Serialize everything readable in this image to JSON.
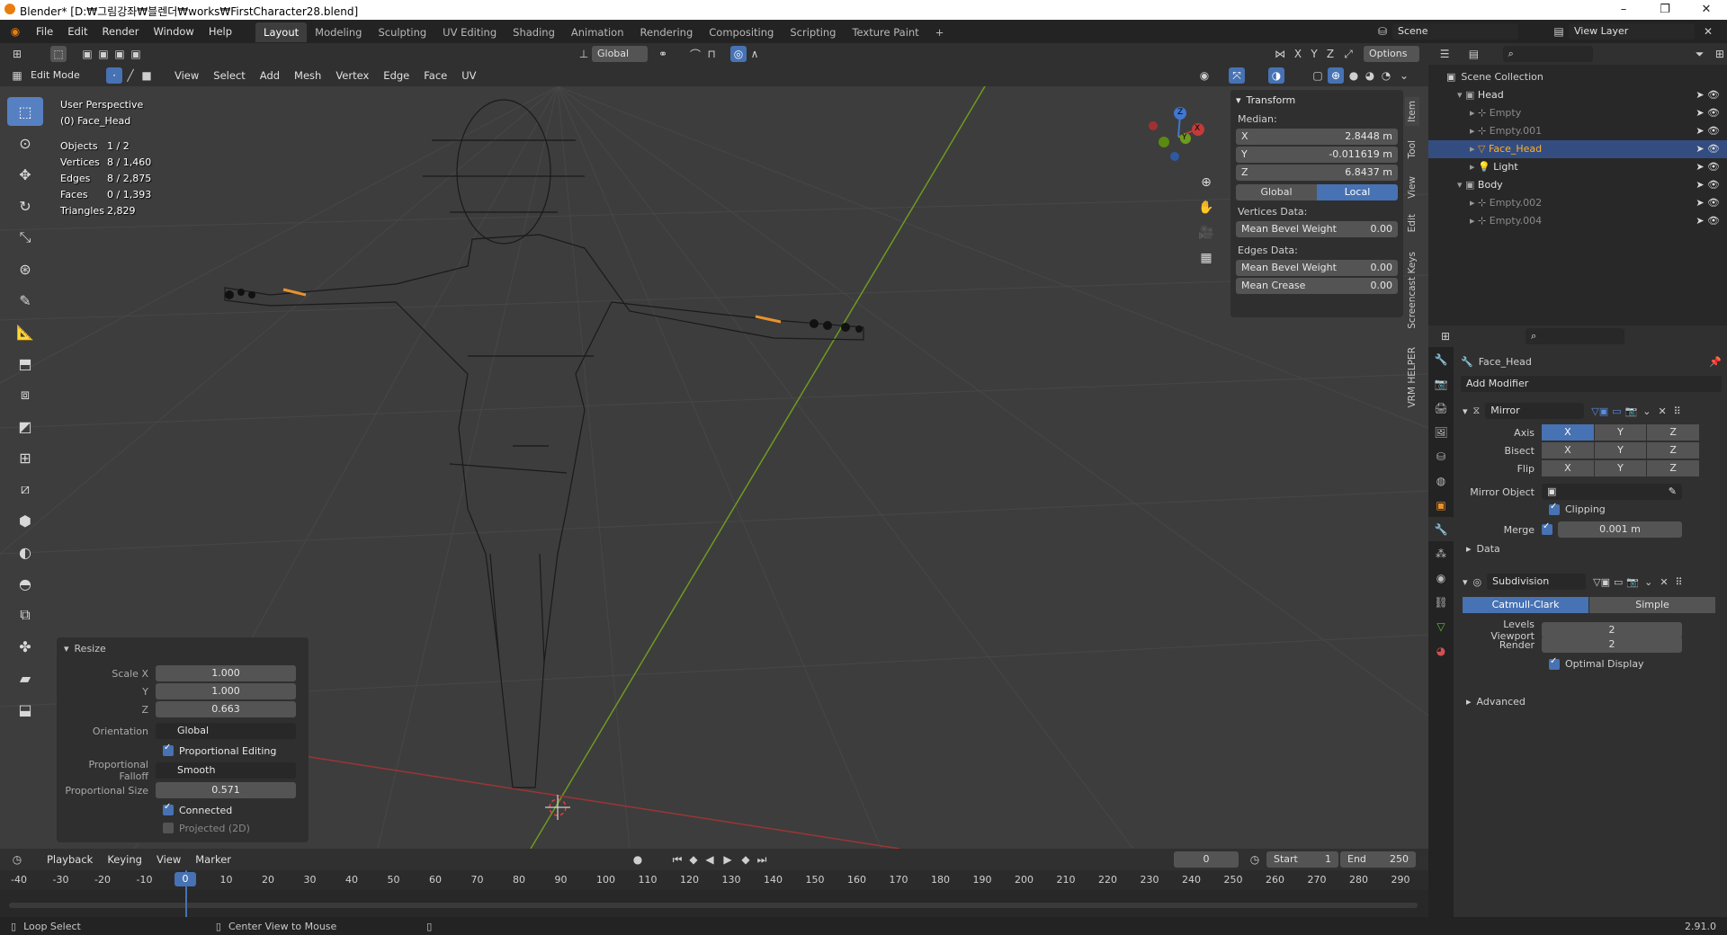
{
  "window": {
    "title": "Blender* [D:₩그림강좌₩블렌더₩works₩FirstCharacter28.blend]",
    "controls": [
      "–",
      "❐",
      "✕"
    ]
  },
  "menu": [
    "File",
    "Edit",
    "Render",
    "Window",
    "Help"
  ],
  "workspaces": [
    "Layout",
    "Modeling",
    "Sculpting",
    "UV Editing",
    "Shading",
    "Animation",
    "Rendering",
    "Compositing",
    "Scripting",
    "Texture Paint"
  ],
  "workspace_add": "+",
  "scene": {
    "label": "Scene",
    "view_layer": "View Layer"
  },
  "tool_header": {
    "orientation": "Global",
    "axes": [
      "X",
      "Y",
      "Z"
    ],
    "options": "Options"
  },
  "vp_header": {
    "mode": "Edit Mode",
    "menus": [
      "View",
      "Select",
      "Add",
      "Mesh",
      "Vertex",
      "Edge",
      "Face",
      "UV"
    ]
  },
  "viewport": {
    "perspective": "User Perspective",
    "object": "(0) Face_Head",
    "stats": [
      {
        "label": "Objects",
        "value": "1 / 2"
      },
      {
        "label": "Vertices",
        "value": "8 / 1,460"
      },
      {
        "label": "Edges",
        "value": "8 / 2,875"
      },
      {
        "label": "Faces",
        "value": "0 / 1,393"
      },
      {
        "label": "Triangles",
        "value": "2,829"
      }
    ],
    "gizmo": {
      "x": "X",
      "y": "Y",
      "z": "Z"
    }
  },
  "npanel": {
    "title": "Transform",
    "median_label": "Median:",
    "x": {
      "label": "X",
      "value": "2.8448 m"
    },
    "y": {
      "label": "Y",
      "value": "-0.011619 m"
    },
    "z": {
      "label": "Z",
      "value": "6.8437 m"
    },
    "space_global": "Global",
    "space_local": "Local",
    "vertices_data": "Vertices Data:",
    "vertex_bevel": {
      "label": "Mean Bevel Weight",
      "value": "0.00"
    },
    "edges_data": "Edges Data:",
    "edge_bevel": {
      "label": "Mean Bevel Weight",
      "value": "0.00"
    },
    "edge_crease": {
      "label": "Mean Crease",
      "value": "0.00"
    },
    "side_tabs": [
      "Item",
      "Tool",
      "View",
      "Edit",
      "Screencast Keys",
      "VRM HELPER"
    ]
  },
  "resize": {
    "title": "Resize",
    "scale_x": {
      "label": "Scale X",
      "value": "1.000"
    },
    "scale_y": {
      "label": "Y",
      "value": "1.000"
    },
    "scale_z": {
      "label": "Z",
      "value": "0.663"
    },
    "orientation": {
      "label": "Orientation",
      "value": "Global"
    },
    "proportional_editing": "Proportional Editing",
    "falloff": {
      "label": "Proportional Falloff",
      "value": "Smooth"
    },
    "size": {
      "label": "Proportional Size",
      "value": "0.571"
    },
    "connected": "Connected",
    "projected": "Projected (2D)"
  },
  "outliner": {
    "root": "Scene Collection",
    "rows": [
      {
        "name": "Head",
        "indent": 1,
        "type": "collection"
      },
      {
        "name": "Empty",
        "indent": 2,
        "type": "empty"
      },
      {
        "name": "Empty.001",
        "indent": 2,
        "type": "empty"
      },
      {
        "name": "Face_Head",
        "indent": 2,
        "type": "mesh",
        "selected": true
      },
      {
        "name": "Light",
        "indent": 2,
        "type": "light"
      },
      {
        "name": "Body",
        "indent": 1,
        "type": "collection"
      },
      {
        "name": "Empty.002",
        "indent": 2,
        "type": "empty"
      },
      {
        "name": "Empty.004",
        "indent": 2,
        "type": "empty"
      }
    ]
  },
  "properties": {
    "object_name": "Face_Head",
    "add_modifier": "Add Modifier",
    "mirror": {
      "name": "Mirror",
      "axis_label": "Axis",
      "bisect_label": "Bisect",
      "flip_label": "Flip",
      "axes": [
        "X",
        "Y",
        "Z"
      ],
      "mirror_object_label": "Mirror Object",
      "clipping": "Clipping",
      "merge_label": "Merge",
      "merge_value": "0.001 m",
      "data": "Data"
    },
    "subdivision": {
      "name": "Subdivision",
      "catmull": "Catmull-Clark",
      "simple": "Simple",
      "levels_viewport": {
        "label": "Levels Viewport",
        "value": "2"
      },
      "render": {
        "label": "Render",
        "value": "2"
      },
      "optimal": "Optimal Display",
      "advanced": "Advanced"
    }
  },
  "timeline": {
    "menus": [
      "Playback",
      "Keying",
      "View",
      "Marker"
    ],
    "current": "0",
    "start_label": "Start",
    "start": "1",
    "end_label": "End",
    "end": "250",
    "ticks": [
      "-40",
      "-30",
      "-20",
      "-10",
      "0",
      "10",
      "20",
      "30",
      "40",
      "50",
      "60",
      "70",
      "80",
      "90",
      "100",
      "110",
      "120",
      "130",
      "140",
      "150",
      "160",
      "170",
      "180",
      "190",
      "200",
      "210",
      "220",
      "230",
      "240",
      "250",
      "260",
      "270",
      "280",
      "290"
    ]
  },
  "statusbar": {
    "left": "Loop Select",
    "middle": "Center View to Mouse",
    "version": "2.91.0"
  },
  "colors": {
    "accent": "#4772b3",
    "selected_row": "#334d80",
    "active_tool": "#5680c2",
    "x_axis": "#c33a3a",
    "y_axis": "#6e9a1f",
    "z_axis": "#3f77d1"
  }
}
